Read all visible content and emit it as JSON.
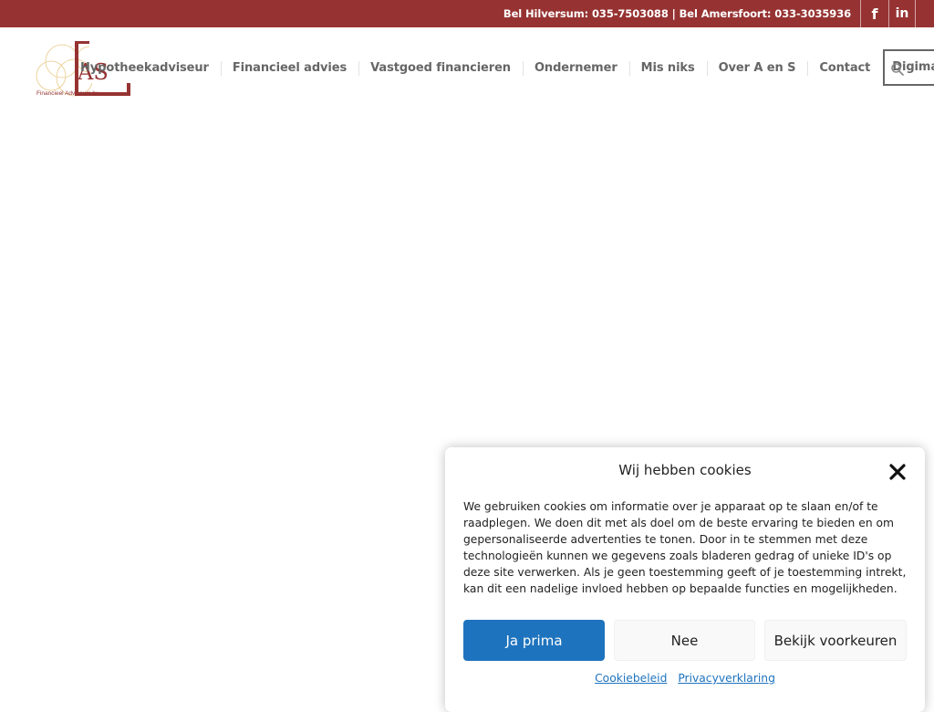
{
  "topbar": {
    "phones": "Bel Hilversum: 035-7503088 | Bel Amersfoort: 033-3035936",
    "facebook_icon": "facebook-icon",
    "linkedin_icon": "linkedin-icon",
    "facebook_glyph": "f",
    "linkedin_glyph": "in"
  },
  "logo": {
    "letters": "AS",
    "tagline": "Financieel Adviseurs bv"
  },
  "nav": {
    "items": [
      {
        "label": "Hypotheekadviseur"
      },
      {
        "label": "Financieel advies"
      },
      {
        "label": "Vastgoed financieren"
      },
      {
        "label": "Ondernemer"
      },
      {
        "label": "Mis niks"
      },
      {
        "label": "Over A en S"
      },
      {
        "label": "Contact"
      },
      {
        "label": "Digimap"
      }
    ],
    "search_icon": "search-icon"
  },
  "cookie": {
    "title": "Wij hebben cookies",
    "text": "We gebruiken cookies om informatie over je apparaat op te slaan en/of te raadplegen. We doen dit met als doel om de beste ervaring te bieden en om gepersonaliseerde advertenties te tonen. Door in te stemmen met deze technologieën kunnen we gegevens zoals bladeren gedrag of unieke ID's op deze site verwerken. Als je geen toestemming geeft of je toestemming intrekt, kan dit een nadelige invloed hebben op bepaalde functies en mogelijkheden.",
    "accept_label": "Ja prima",
    "deny_label": "Nee",
    "prefs_label": "Bekijk voorkeuren",
    "link_policy": "Cookiebeleid",
    "link_privacy": "Privacyverklaring",
    "close_icon": "close-icon"
  },
  "colors": {
    "brand": "#963332",
    "nav_text": "#666666",
    "accept_button": "#1e73be"
  }
}
